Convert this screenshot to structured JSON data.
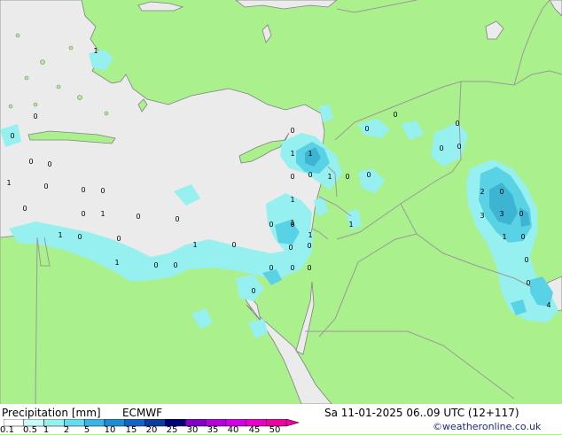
{
  "title": "Precipitation [mm]",
  "model": "ECMWF",
  "datetime": "Sa 11-01-2025 06..09 UTC (12+117)",
  "credit": "©weatheronline.co.uk",
  "colors": {
    "land": "#aaf08c",
    "sea": "#ebebeb",
    "border": "#9a9a9a",
    "coast": "#808080",
    "light_precip": "#96f0f0",
    "mid_precip": "#5ad2e6",
    "heavy_precip": "#3cb4d2"
  },
  "scale": {
    "labels": [
      "0.1",
      "0.5",
      "1",
      "2",
      "5",
      "10",
      "15",
      "20",
      "25",
      "30",
      "35",
      "40",
      "45",
      "50"
    ],
    "colors": [
      "#ffffff",
      "#c8fafa",
      "#96f0f0",
      "#64dcf0",
      "#3cb4e6",
      "#1e8cd2",
      "#1464c8",
      "#0a3ca0",
      "#000078",
      "#8200c8",
      "#b400dc",
      "#d200e6",
      "#e600c8",
      "#f000a0"
    ]
  },
  "map_labels": [
    {
      "text": "1"
    },
    {
      "text": "0"
    },
    {
      "text": "0"
    },
    {
      "text": "0"
    },
    {
      "text": "0"
    },
    {
      "text": "1"
    },
    {
      "text": "0"
    },
    {
      "text": "0"
    },
    {
      "text": "0"
    },
    {
      "text": "0"
    },
    {
      "text": "0"
    },
    {
      "text": "1"
    },
    {
      "text": "1"
    },
    {
      "text": "0"
    },
    {
      "text": "0"
    },
    {
      "text": "1"
    },
    {
      "text": "0"
    },
    {
      "text": "1"
    },
    {
      "text": "0"
    },
    {
      "text": "0"
    },
    {
      "text": "1"
    },
    {
      "text": "1"
    },
    {
      "text": "1"
    },
    {
      "text": "0"
    },
    {
      "text": "0"
    },
    {
      "text": "0"
    },
    {
      "text": "0"
    },
    {
      "text": "1"
    },
    {
      "text": "0"
    },
    {
      "text": "1"
    },
    {
      "text": "0"
    },
    {
      "text": "0"
    },
    {
      "text": "0"
    },
    {
      "text": "0"
    },
    {
      "text": "0"
    },
    {
      "text": "0"
    },
    {
      "text": "0"
    },
    {
      "text": "0"
    },
    {
      "text": "0"
    },
    {
      "text": "1"
    },
    {
      "text": "0"
    },
    {
      "text": "0"
    },
    {
      "text": "0"
    },
    {
      "text": "0"
    },
    {
      "text": "0"
    },
    {
      "text": "0"
    },
    {
      "text": "1"
    },
    {
      "text": "2"
    },
    {
      "text": "0"
    },
    {
      "text": "3"
    },
    {
      "text": "3"
    },
    {
      "text": "0"
    },
    {
      "text": "1"
    },
    {
      "text": "0"
    },
    {
      "text": "0"
    },
    {
      "text": "0"
    },
    {
      "text": "4"
    }
  ]
}
